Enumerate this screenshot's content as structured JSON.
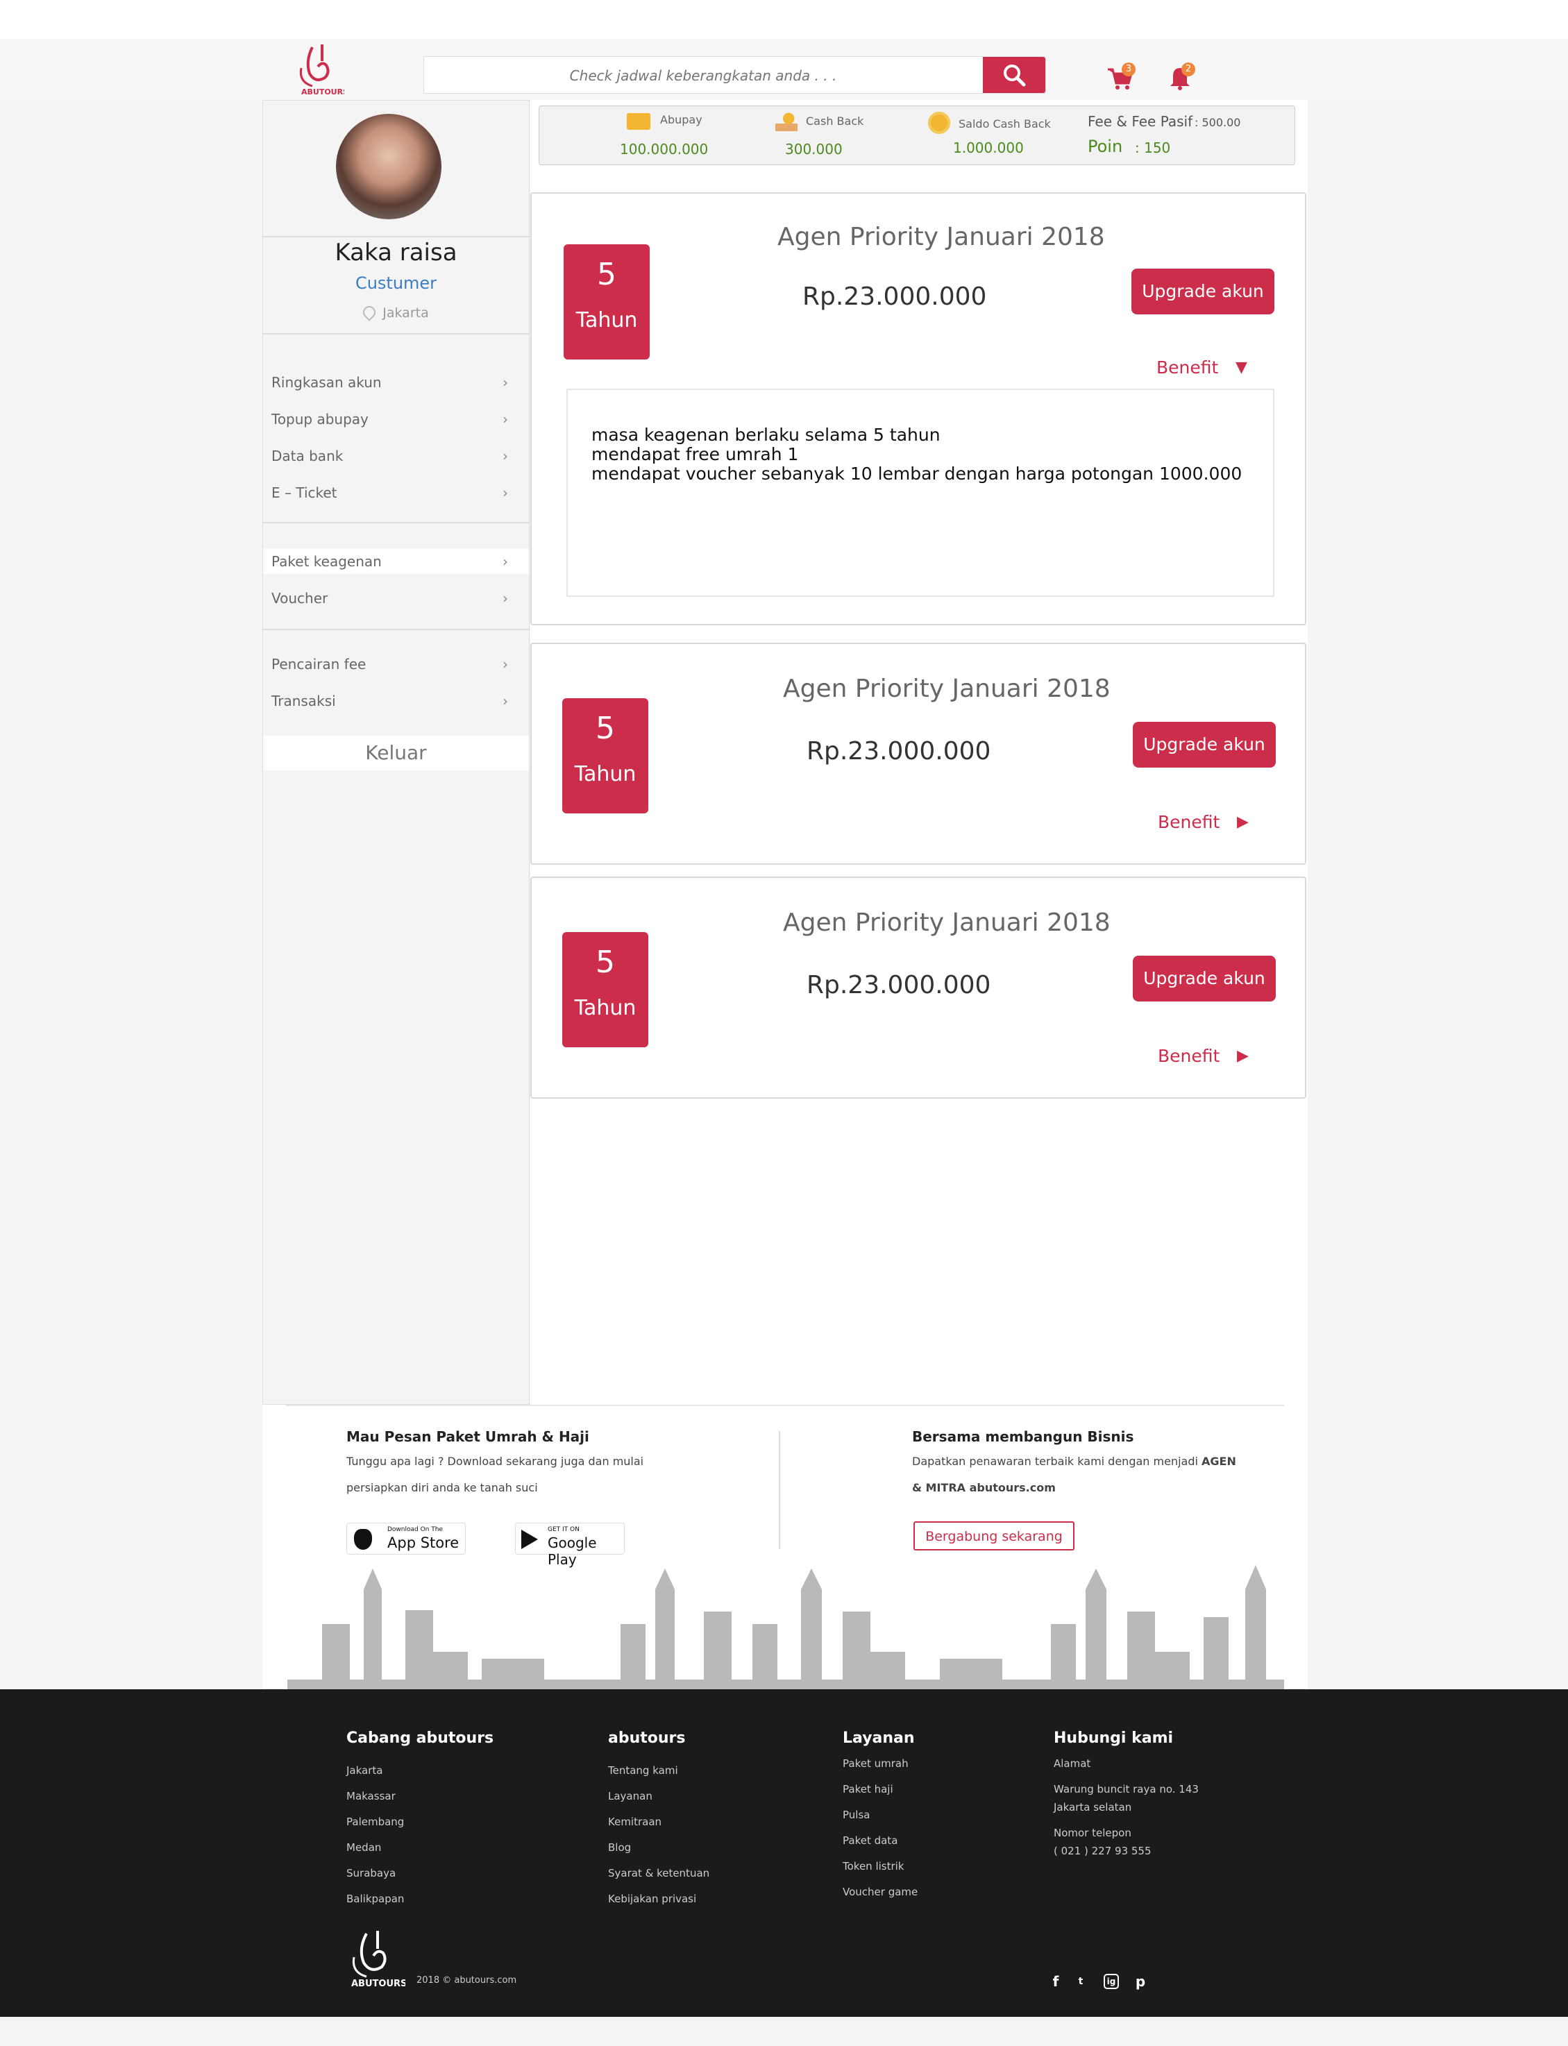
{
  "header": {
    "logo_text": "ABUTOURS",
    "search_placeholder": "Check jadwal keberangkatan anda . . .",
    "cart_count": "3",
    "notif_count": "2"
  },
  "wallet": {
    "abupay_label": "Abupay",
    "abupay_value": "100.000.000",
    "cashback_label": "Cash Back",
    "cashback_value": "300.000",
    "saldo_label": "Saldo Cash Back",
    "saldo_value": "1.000.000",
    "fee_label": "Fee & Fee Pasif",
    "fee_value": ": 500.00",
    "poin_label": "Poin",
    "poin_value": ": 150"
  },
  "profile": {
    "name": "Kaka raisa",
    "role": "Custumer",
    "location": "Jakarta"
  },
  "menu": {
    "group1": [
      "Ringkasan akun",
      "Topup abupay",
      "Data bank",
      "E – Ticket"
    ],
    "group2": [
      "Paket keagenan",
      "Voucher"
    ],
    "group3": [
      "Pencairan fee",
      "Transaksi"
    ],
    "logout": "Keluar",
    "chevron": "›"
  },
  "cards": [
    {
      "years": "5",
      "unit": "Tahun",
      "title": "Agen Priority Januari 2018",
      "price": "Rp.23.000.000",
      "button": "Upgrade akun",
      "benefit": "Benefit",
      "arrow": "▼"
    },
    {
      "years": "5",
      "unit": "Tahun",
      "title": "Agen Priority Januari 2018",
      "price": "Rp.23.000.000",
      "button": "Upgrade akun",
      "benefit": "Benefit",
      "arrow": "▶"
    },
    {
      "years": "5",
      "unit": "Tahun",
      "title": "Agen Priority Januari 2018",
      "price": "Rp.23.000.000",
      "button": "Upgrade akun",
      "benefit": "Benefit",
      "arrow": "▶"
    }
  ],
  "benefit_lines": [
    "masa keagenan berlaku selama 5 tahun",
    "mendapat free umrah 1",
    "mendapat voucher sebanyak 10 lembar dengan harga potongan 1000.000"
  ],
  "promo": {
    "left_title": "Mau Pesan Paket Umrah & Haji",
    "left_text1": "Tunggu apa lagi ? Download sekarang juga dan mulai",
    "left_text2": "persiapkan diri anda ke tanah suci",
    "appstore_small": "Download On The",
    "appstore_big": "App Store",
    "gplay_small": "GET IT ON",
    "gplay_big": "Google Play",
    "right_title": "Bersama membangun Bisnis",
    "right_text1": "Dapatkan penawaran terbaik kami dengan menjadi",
    "right_text1_bold": "AGEN",
    "right_text2": "& MITRA abutours.com",
    "join_button": "Bergabung sekarang"
  },
  "footer": {
    "col1_title": "Cabang abutours",
    "col1_items": [
      "Jakarta",
      "Makassar",
      "Palembang",
      "Medan",
      "Surabaya",
      "Balikpapan"
    ],
    "col2_title": "abutours",
    "col2_items": [
      "Tentang kami",
      "Layanan",
      "Kemitraan",
      "Blog",
      "Syarat & ketentuan",
      "Kebijakan privasi"
    ],
    "col3_title": "Layanan",
    "col3_items": [
      "Paket umrah",
      "Paket haji",
      "Pulsa",
      "Paket data",
      "Token listrik",
      "Voucher game"
    ],
    "col4_title": "Hubungi kami",
    "address_label": "Alamat",
    "address_line1": "Warung buncit raya no. 143",
    "address_line2": "Jakarta selatan",
    "phone_label": "Nomor telepon",
    "phone_value": "( 021 )  227 93 555",
    "copyright": "2018 © abutours.com",
    "logo_text": "ABUTOURS",
    "social": [
      "f",
      "t",
      "ig",
      "p"
    ]
  },
  "colors": {
    "brand_red": "#cc2d4a",
    "link_blue": "#3b7dc4",
    "money_green": "#4d8a1e",
    "footer_dark": "#1b1b1b"
  }
}
